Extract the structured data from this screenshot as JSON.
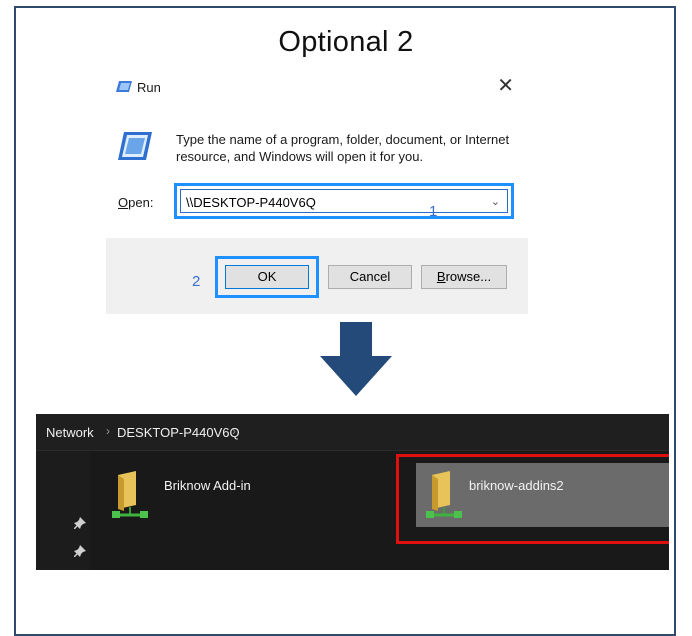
{
  "slide": {
    "title": "Optional 2"
  },
  "run_dialog": {
    "title": "Run",
    "close_glyph": "✕",
    "description": "Type the name of a program, folder, document, or Internet resource, and Windows will open it for you.",
    "open_label_accel": "O",
    "open_label_rest": "pen:",
    "open_value": "\\\\DESKTOP-P440V6Q",
    "annotation_1": "1",
    "ok_label": "OK",
    "cancel_label": "Cancel",
    "browse_label_accel": "B",
    "browse_label_rest": "rowse...",
    "annotation_2": "2",
    "icons": [
      "run-icon",
      "chevron-down-icon"
    ]
  },
  "explorer": {
    "breadcrumb": [
      "Network",
      "DESKTOP-P440V6Q"
    ],
    "breadcrumb_separator": "›",
    "items": [
      {
        "label": "Briknow Add-in",
        "icon": "network-folder-icon",
        "selected": false
      },
      {
        "label": "briknow-addins2",
        "icon": "network-folder-icon",
        "selected": true
      }
    ],
    "icons": [
      "pin-icon",
      "network-folder-icon"
    ]
  },
  "colors": {
    "highlight_blue": "#1e90ff",
    "highlight_red": "#e01010",
    "arrow": "#244a7a",
    "explorer_bg": "#191919",
    "selected_bg": "#6b6b6b"
  }
}
